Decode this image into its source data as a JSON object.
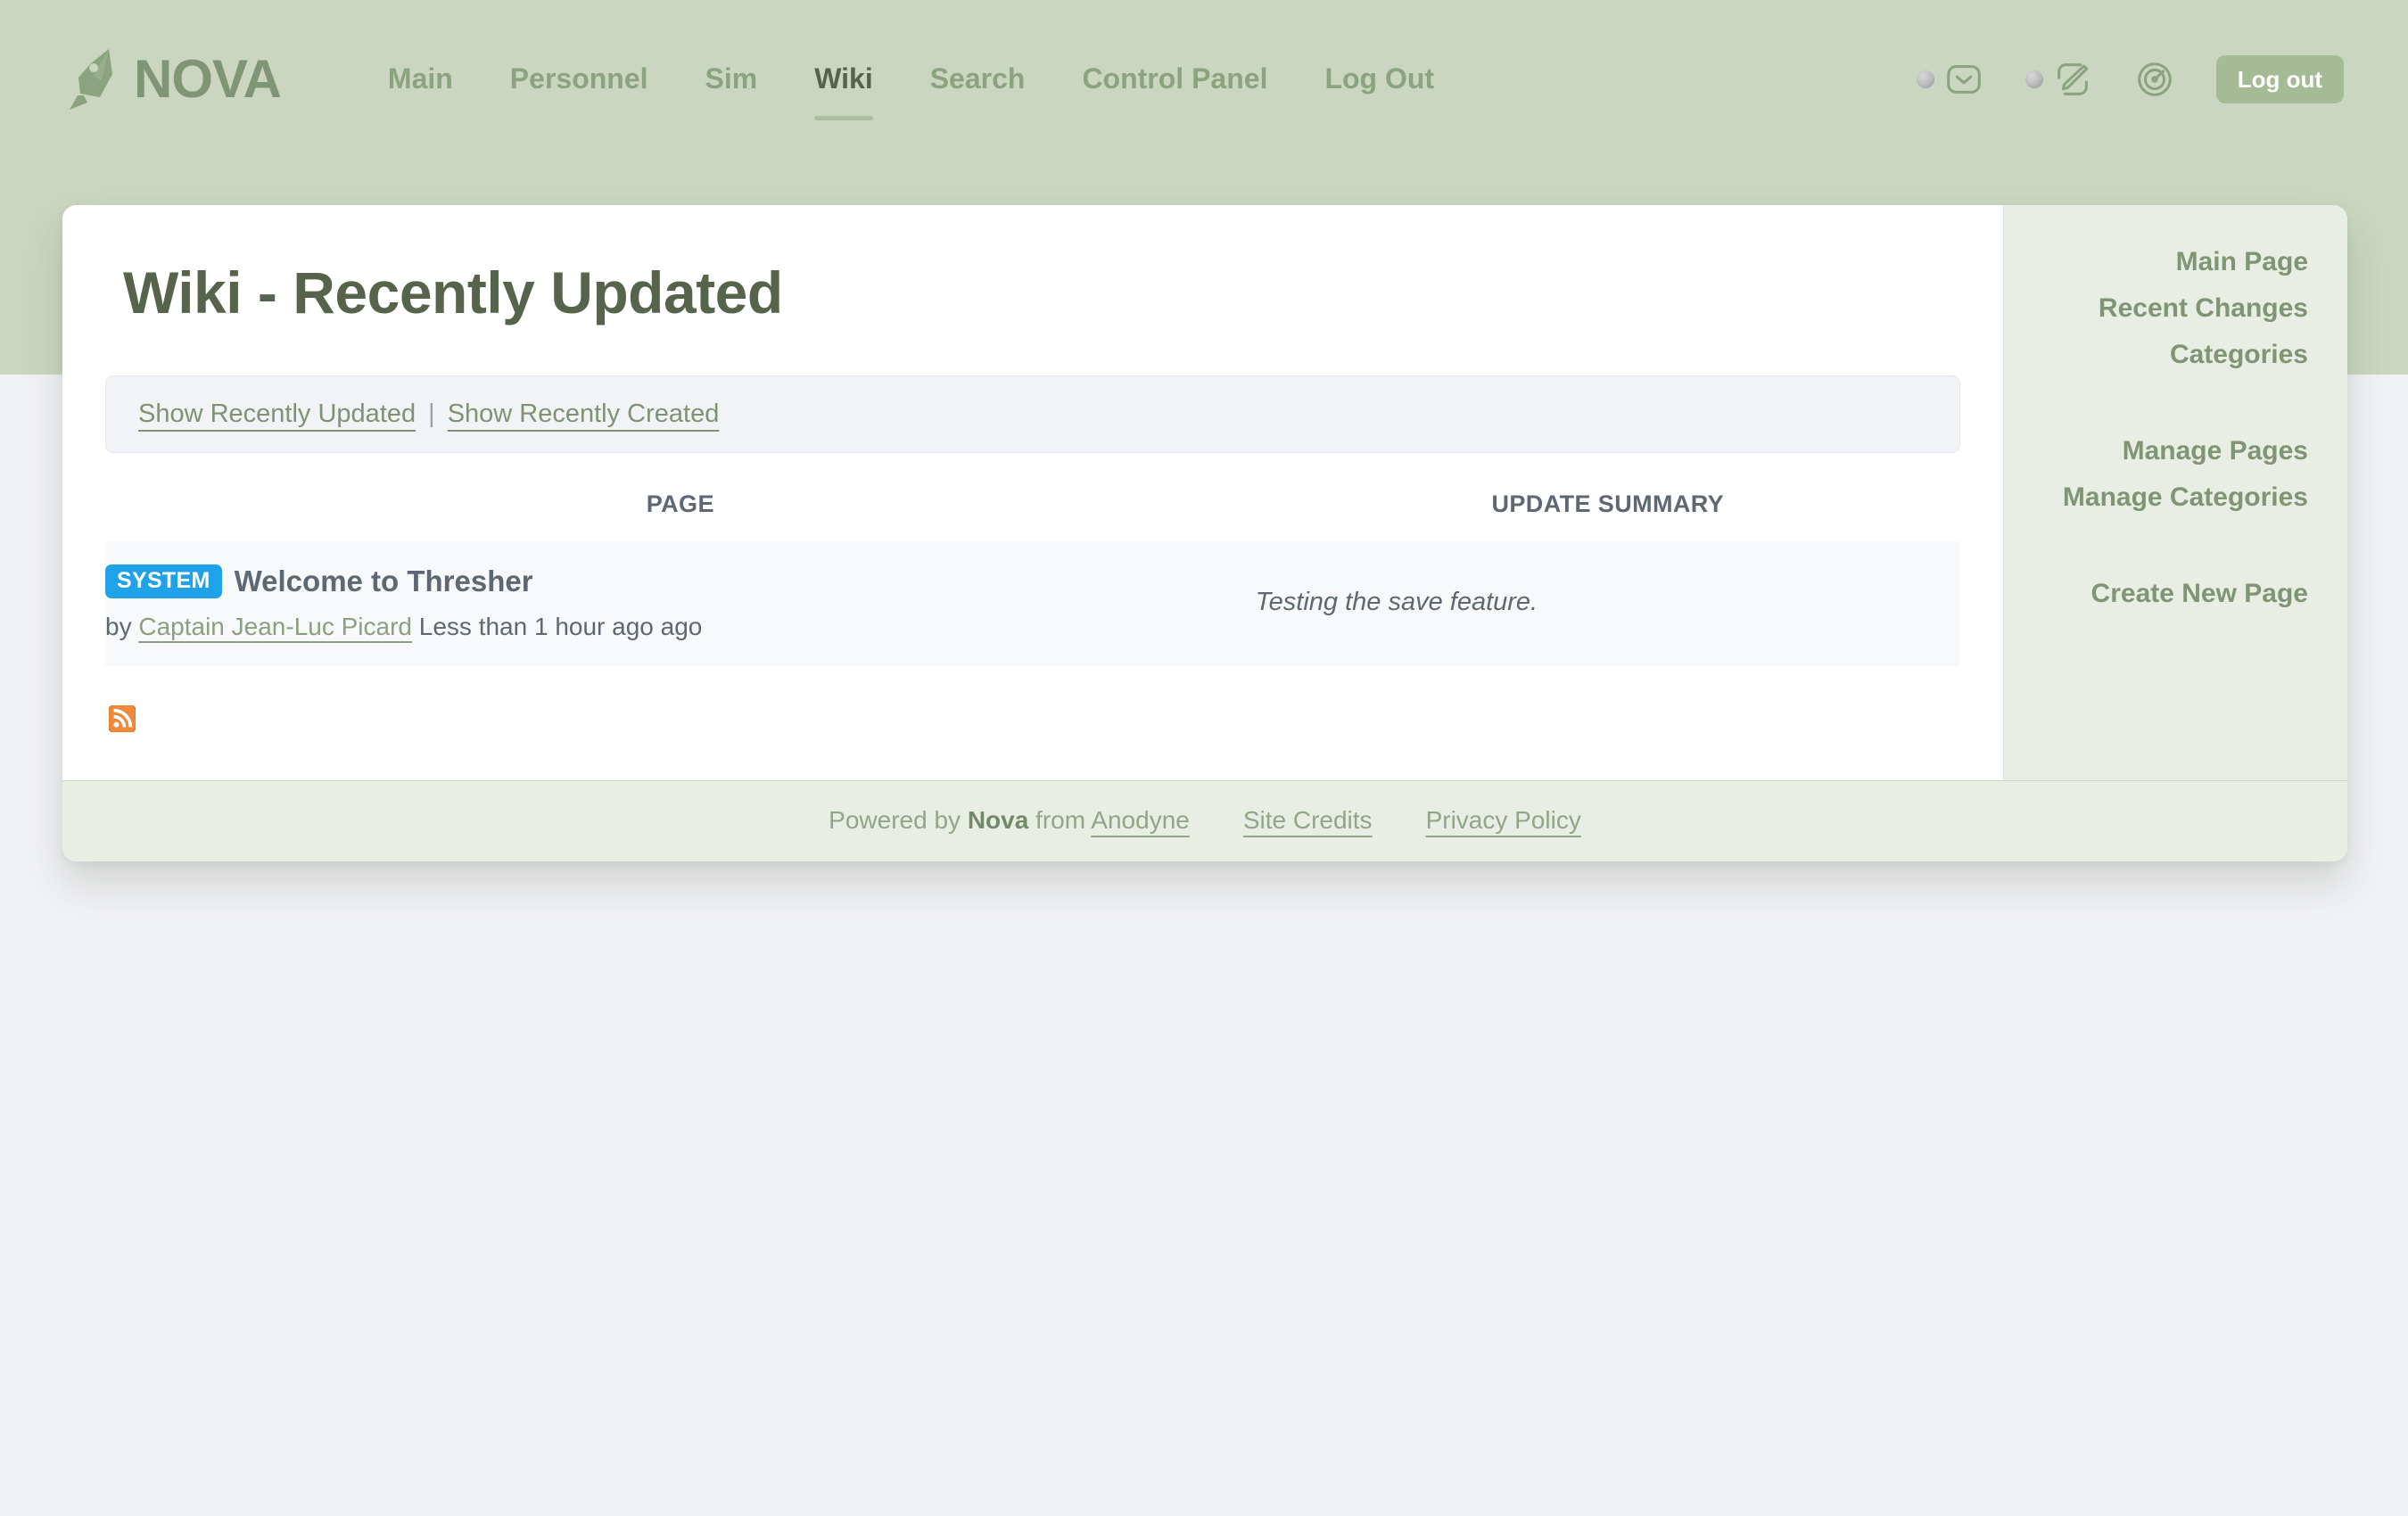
{
  "brand": {
    "name": "NOVA",
    "logo_icon": "pen-nib-icon",
    "accent_green": "#8ba37f",
    "header_band": "#cad6c0",
    "page_bg": "#f1f2f5"
  },
  "nav": {
    "items": [
      {
        "label": "Main",
        "active": false
      },
      {
        "label": "Personnel",
        "active": false
      },
      {
        "label": "Sim",
        "active": false
      },
      {
        "label": "Wiki",
        "active": true
      },
      {
        "label": "Search",
        "active": false
      },
      {
        "label": "Control Panel",
        "active": false
      },
      {
        "label": "Log Out",
        "active": false
      }
    ],
    "icons": [
      {
        "name": "mail-icon",
        "badge": true
      },
      {
        "name": "pencil-edit-icon",
        "badge": true
      },
      {
        "name": "radar-icon",
        "badge": false
      }
    ],
    "logout_button": "Log out",
    "logout_button_color": "#a5bb96"
  },
  "main": {
    "title": "Wiki - Recently Updated",
    "tabs": [
      {
        "label": "Show Recently Updated"
      },
      {
        "label": "Show Recently Created"
      }
    ],
    "tab_separator": "|",
    "table": {
      "headers": [
        "PAGE",
        "UPDATE SUMMARY"
      ],
      "rows": [
        {
          "badge": "SYSTEM",
          "badge_color": "#1fa2e8",
          "page_name": "Welcome to Thresher",
          "meta_prefix": "by ",
          "author": "Captain Jean-Luc Picard",
          "meta_suffix": " Less than 1 hour ago ago",
          "summary": "Testing the save feature."
        }
      ]
    },
    "rss": {
      "icon": "rss-feed-icon",
      "color": "#ee8336"
    }
  },
  "sidebar": {
    "groups": [
      {
        "items": [
          {
            "label": "Main Page"
          },
          {
            "label": "Recent Changes"
          },
          {
            "label": "Categories"
          }
        ]
      },
      {
        "items": [
          {
            "label": "Manage Pages"
          },
          {
            "label": "Manage Categories"
          }
        ]
      },
      {
        "items": [
          {
            "label": "Create New Page"
          }
        ]
      }
    ]
  },
  "footer": {
    "powered_prefix": "Powered by ",
    "powered_brand": "Nova",
    "powered_mid": " from ",
    "powered_source": "Anodyne",
    "links": [
      {
        "label": "Site Credits"
      },
      {
        "label": "Privacy Policy"
      }
    ]
  }
}
